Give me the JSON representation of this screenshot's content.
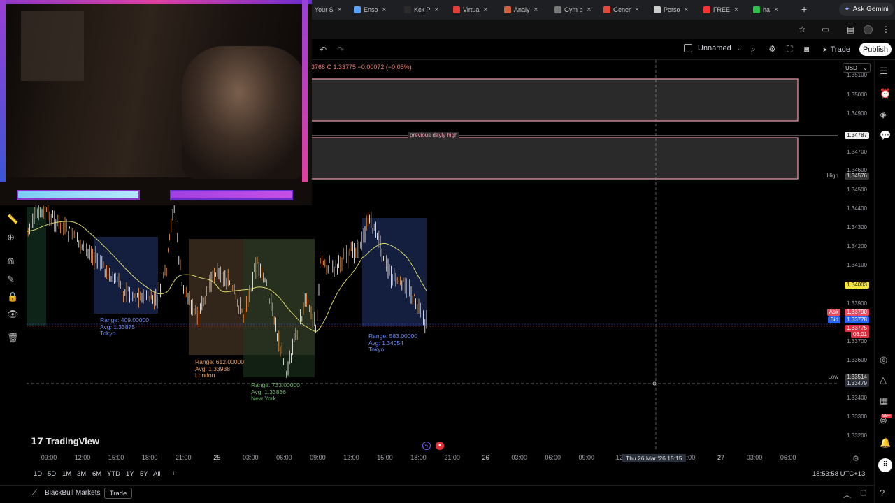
{
  "browser": {
    "tabs": [
      {
        "label": "Your S",
        "color": "#9aa0a6"
      },
      {
        "label": "Enso",
        "color": "#5aa0ff"
      },
      {
        "label": "Kck P",
        "color": "#2b2b2b"
      },
      {
        "label": "Virtua",
        "color": "#e0403a"
      },
      {
        "label": "Analy",
        "color": "#d06040"
      },
      {
        "label": "Gym b",
        "color": "#777777"
      },
      {
        "label": "Gener",
        "color": "#e24a3a"
      },
      {
        "label": "Perso",
        "color": "#cccccc"
      },
      {
        "label": "FREE",
        "color": "#ff3030"
      },
      {
        "label": "ha",
        "color": "#2fbf4a"
      }
    ],
    "ask_gemini": "Ask Gemini"
  },
  "toolbar": {
    "layout_name": "Unnamed",
    "trade_label": "Trade",
    "publish_label": "Publish"
  },
  "ohlc": "33768  C 1.33775  −0.00072 (−0.05%)",
  "currency": "USD",
  "annotations": {
    "prev_high": "previous dayly high",
    "tokyo1": {
      "range": "Range: 409.00000",
      "avg": "Avg: 1.33875",
      "name": "Tokyo"
    },
    "london": {
      "range": "Range: 612.00000",
      "avg": "Avg: 1.33938",
      "name": "London"
    },
    "newyork": {
      "range": "Range: 733.00000",
      "avg": "Avg: 1.33836",
      "name": "New York"
    },
    "tokyo2": {
      "range": "Range: 583.00000",
      "avg": "Avg: 1.34054",
      "name": "Tokyo"
    }
  },
  "price_axis": {
    "ticks": [
      "1.35100",
      "1.35000",
      "1.34900",
      "1.34700",
      "1.34600",
      "1.34500",
      "1.34400",
      "1.34300",
      "1.34200",
      "1.34100",
      "1.33900",
      "1.33700",
      "1.33600",
      "1.33400",
      "1.33300",
      "1.33200"
    ],
    "labels": {
      "prev_high_value": "1.34787",
      "high_tag": "High",
      "high_value": "1.34576",
      "yellow_value": "1.34003",
      "ask_tag": "Ask",
      "ask_value": "1.33790",
      "bid_tag": "Bid",
      "bid_value": "1.33778",
      "last_value": "1.33775",
      "countdown": "06:01",
      "low_tag": "Low",
      "low_value": "1.33514",
      "cursor_value": "1.33479"
    },
    "colors": {
      "ask": "#e84a5f",
      "bid": "#2962ff",
      "last": "#e03040",
      "yellow": "#f5e342",
      "high": "#505050"
    }
  },
  "time_axis": {
    "ticks": [
      "09:00",
      "12:00",
      "15:00",
      "18:00",
      "21:00",
      "25",
      "03:00",
      "06:00",
      "09:00",
      "12:00",
      "15:00",
      "18:00",
      "21:00",
      "26",
      "03:00",
      "06:00",
      "09:00",
      "12:",
      "",
      "21:00",
      "27",
      "03:00",
      "06:00"
    ],
    "cursor_label": "Thu 26 Mar '26   15:15"
  },
  "ranges": [
    "1D",
    "5D",
    "1M",
    "3M",
    "6M",
    "YTD",
    "1Y",
    "5Y",
    "All"
  ],
  "clock": "18:53:58 UTC+13",
  "footer": {
    "broker": "BlackBull Markets",
    "trade": "Trade"
  },
  "watermark": "TradingView",
  "notif_badge": "99+",
  "chart_data": {
    "type": "candlestick",
    "symbol_quote": {
      "close": 1.33775,
      "change": -0.00072,
      "change_pct": -0.05
    },
    "levels": {
      "previous_daily_high": 1.34787,
      "high": 1.34576,
      "low": 1.33514,
      "ask": 1.3379,
      "bid": 1.33778
    }
  }
}
